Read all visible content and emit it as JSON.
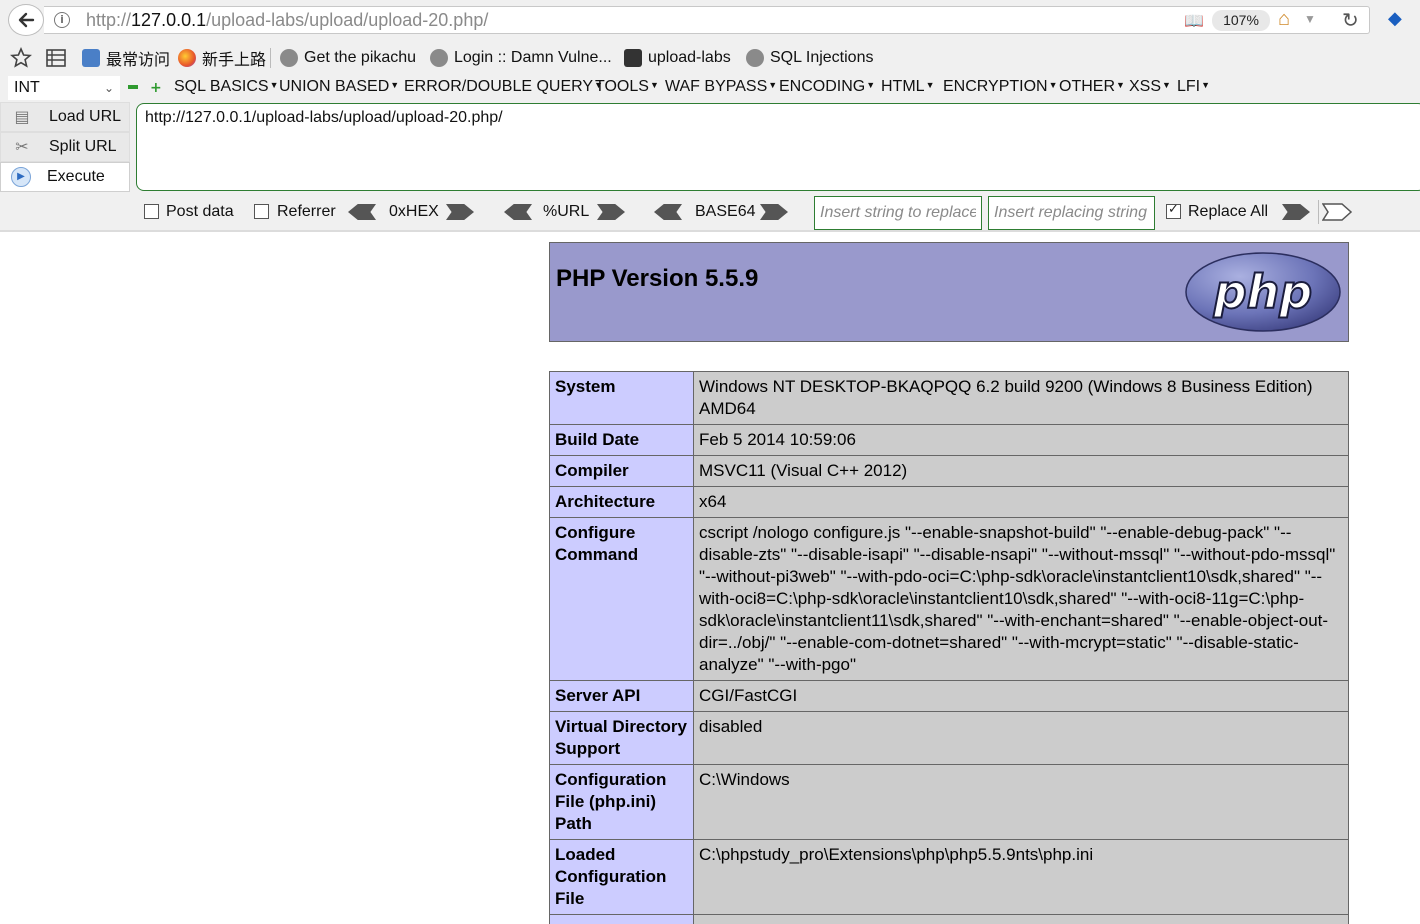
{
  "browser": {
    "url_prefix": "http://",
    "url_host": "127.0.0.1",
    "url_path": "/upload-labs/upload/upload-20.php/",
    "zoom": "107%"
  },
  "bookmarks": [
    {
      "label": "最常访问"
    },
    {
      "label": "新手上路"
    },
    {
      "label": "Get the pikachu"
    },
    {
      "label": "Login :: Damn Vulne..."
    },
    {
      "label": "upload-labs"
    },
    {
      "label": "SQL Injections"
    }
  ],
  "hackbar": {
    "type_select": "INT",
    "menu": [
      "SQL BASICS",
      "UNION BASED",
      "ERROR/DOUBLE QUERY",
      "TOOLS",
      "WAF BYPASS",
      "ENCODING",
      "HTML",
      "ENCRYPTION",
      "OTHER",
      "XSS",
      "LFI"
    ],
    "load_url": "Load URL",
    "split_url": "Split URL",
    "execute": "Execute",
    "url_value": "http://127.0.0.1/upload-labs/upload/upload-20.php/",
    "post_data": "Post data",
    "referrer": "Referrer",
    "hex": "0xHEX",
    "url_enc": "%URL",
    "base64": "BASE64",
    "find_placeholder": "Insert string to replace",
    "replace_placeholder": "Insert replacing string",
    "replace_all": "Replace All",
    "replace_all_checked": true
  },
  "php": {
    "title": "PHP Version 5.5.9",
    "logo_text": "php",
    "rows": [
      {
        "key": "System",
        "value": "Windows NT DESKTOP-BKAQPQQ 6.2 build 9200 (Windows 8 Business Edition) AMD64"
      },
      {
        "key": "Build Date",
        "value": "Feb 5 2014 10:59:06"
      },
      {
        "key": "Compiler",
        "value": "MSVC11 (Visual C++ 2012)"
      },
      {
        "key": "Architecture",
        "value": "x64"
      },
      {
        "key": "Configure Command",
        "value": "cscript /nologo configure.js \"--enable-snapshot-build\" \"--enable-debug-pack\" \"--disable-zts\" \"--disable-isapi\" \"--disable-nsapi\" \"--without-mssql\" \"--without-pdo-mssql\" \"--without-pi3web\" \"--with-pdo-oci=C:\\php-sdk\\oracle\\instantclient10\\sdk,shared\" \"--with-oci8=C:\\php-sdk\\oracle\\instantclient10\\sdk,shared\" \"--with-oci8-11g=C:\\php-sdk\\oracle\\instantclient11\\sdk,shared\" \"--with-enchant=shared\" \"--enable-object-out-dir=../obj/\" \"--enable-com-dotnet=shared\" \"--with-mcrypt=static\" \"--disable-static-analyze\" \"--with-pgo\""
      },
      {
        "key": "Server API",
        "value": "CGI/FastCGI"
      },
      {
        "key": "Virtual Directory Support",
        "value": "disabled"
      },
      {
        "key": "Configuration File (php.ini) Path",
        "value": "C:\\Windows"
      },
      {
        "key": "Loaded Configuration File",
        "value": "C:\\phpstudy_pro\\Extensions\\php\\php5.5.9nts\\php.ini"
      },
      {
        "key": "",
        "value": ""
      }
    ]
  },
  "colors": {
    "php_header_bg": "#9999cc",
    "php_key_bg": "#ccccff",
    "php_value_bg": "#cccccc",
    "hackbar_border": "#2e7d32"
  }
}
